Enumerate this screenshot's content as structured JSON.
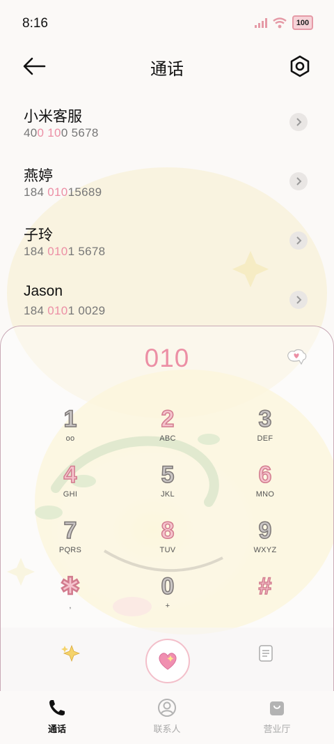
{
  "status_bar": {
    "time": "8:16",
    "battery": "100"
  },
  "header": {
    "title": "通话"
  },
  "contacts": [
    {
      "name": "小米客服",
      "number_parts": [
        "40",
        "0 10",
        "0 5678"
      ]
    },
    {
      "name": "燕婷",
      "number_parts": [
        "184 ",
        "010",
        "15689"
      ]
    },
    {
      "name": "子玲",
      "number_parts": [
        "184 ",
        "010",
        "1 5678"
      ]
    },
    {
      "name": "Jason",
      "number_parts": [
        "184 ",
        "010",
        "1 0029"
      ]
    }
  ],
  "dialer": {
    "input": "010",
    "keys": [
      {
        "digit": "1",
        "letters": "oo"
      },
      {
        "digit": "2",
        "letters": "ABC"
      },
      {
        "digit": "3",
        "letters": "DEF"
      },
      {
        "digit": "4",
        "letters": "GHI"
      },
      {
        "digit": "5",
        "letters": "JKL"
      },
      {
        "digit": "6",
        "letters": "MNO"
      },
      {
        "digit": "7",
        "letters": "PQRS"
      },
      {
        "digit": "8",
        "letters": "TUV"
      },
      {
        "digit": "9",
        "letters": "WXYZ"
      },
      {
        "digit": "✱",
        "letters": ","
      },
      {
        "digit": "0",
        "letters": "+"
      },
      {
        "digit": "#",
        "letters": ""
      }
    ]
  },
  "bottom_nav": [
    {
      "label": "通话",
      "icon": "phone-icon",
      "active": true
    },
    {
      "label": "联系人",
      "icon": "person-icon",
      "active": false
    },
    {
      "label": "营业厅",
      "icon": "bag-icon",
      "active": false
    }
  ],
  "colors": {
    "accent": "#ec8fa5",
    "panel_border": "#c9a9b6"
  }
}
